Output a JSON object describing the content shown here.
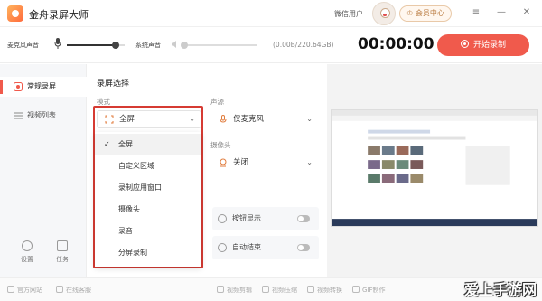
{
  "app": {
    "title": "金舟录屏大师",
    "user_label": "微信用户",
    "member_button": "会员中心"
  },
  "window_controls": [
    "≡",
    "—",
    "✕"
  ],
  "record_bar": {
    "mic_label": "麦克风声音",
    "mic_level": 0.85,
    "system_label": "系统声音",
    "system_level": 0.0,
    "storage": "(0.00B/220.64GB)",
    "timer": "00:00:00",
    "start_button": "开始录制"
  },
  "sidebar": {
    "items": [
      {
        "label": "常规录屏",
        "icon": "record-icon",
        "active": true
      },
      {
        "label": "视频列表",
        "icon": "list-icon",
        "active": false
      }
    ],
    "bottom": [
      {
        "label": "设置",
        "icon": "gear-icon"
      },
      {
        "label": "任务",
        "icon": "task-icon"
      }
    ]
  },
  "settings": {
    "section_title": "录屏选择",
    "mode_label": "模式",
    "mode_value": "全屏",
    "source_label": "声源",
    "source_value": "仅麦克风",
    "camera_label": "摄像头",
    "camera_value": "关闭",
    "toggles": [
      {
        "label": "按钮显示",
        "on": false
      },
      {
        "label": "自动结束",
        "on": false
      }
    ]
  },
  "dropdown": {
    "options": [
      "全屏",
      "自定义区域",
      "录制应用窗口",
      "摄像头",
      "录音",
      "分屏录制"
    ],
    "selected_index": 0
  },
  "footer": {
    "items": [
      "官方网站",
      "在线客服",
      "视频剪辑",
      "视频压缩",
      "视频转换",
      "GIF制作"
    ]
  },
  "watermark": "爱上手游网"
}
